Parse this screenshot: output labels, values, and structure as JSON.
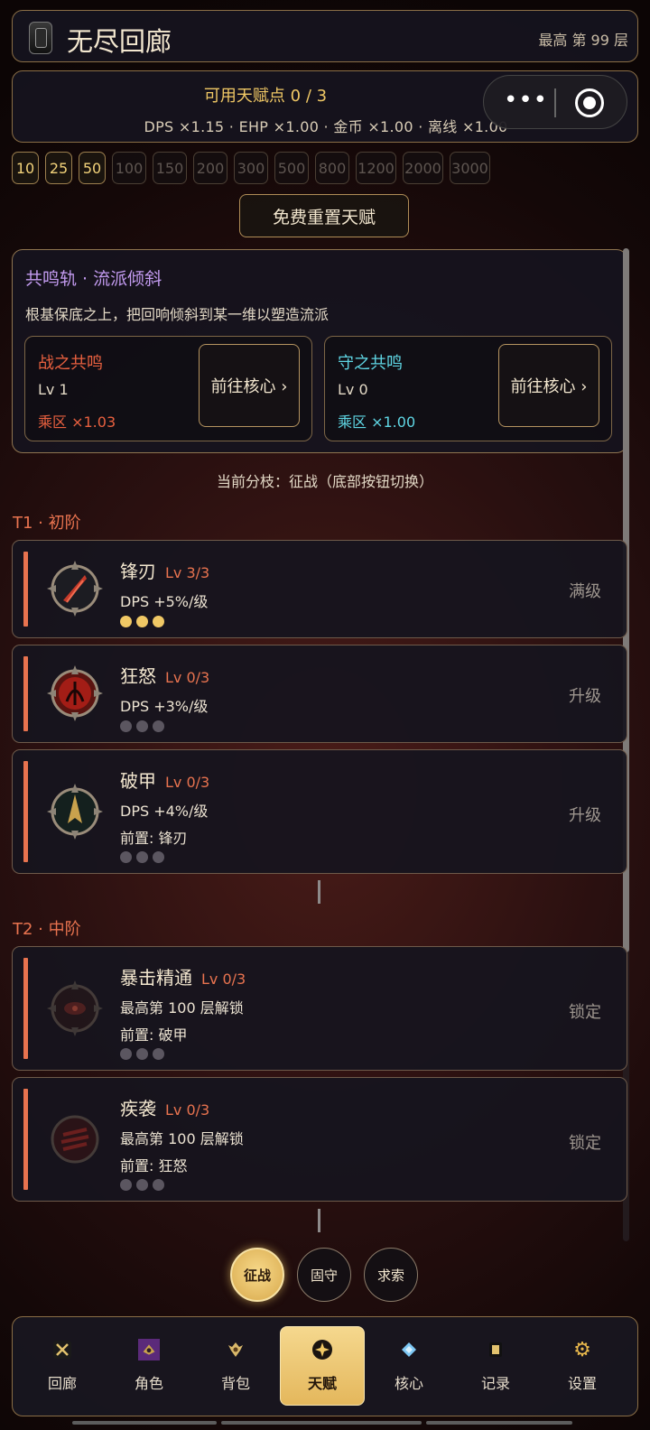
{
  "header": {
    "title": "无尽回廊",
    "best_floor": "最高 第 99 层"
  },
  "talents": {
    "points": "可用天赋点 0 / 3",
    "multipliers": "DPS ×1.15  ·  EHP ×1.00  ·  金币 ×1.00  ·  离线 ×1.00"
  },
  "floors": [
    {
      "label": "10",
      "active": true
    },
    {
      "label": "25",
      "active": true
    },
    {
      "label": "50",
      "active": true
    },
    {
      "label": "100",
      "active": false
    },
    {
      "label": "150",
      "active": false
    },
    {
      "label": "200",
      "active": false
    },
    {
      "label": "300",
      "active": false
    },
    {
      "label": "500",
      "active": false
    },
    {
      "label": "800",
      "active": false
    },
    {
      "label": "1200",
      "active": false
    },
    {
      "label": "2000",
      "active": false
    },
    {
      "label": "3000",
      "active": false
    }
  ],
  "reset_button": "免费重置天赋",
  "resonance": {
    "title": "共鸣轨 · 流派倾斜",
    "desc": "根基保底之上，把回响倾斜到某一维以塑造流派",
    "cards": [
      {
        "name": "战之共鸣",
        "lv": "Lv 1",
        "mult": "乘区 ×1.03",
        "go": "前往核心 ›"
      },
      {
        "name": "守之共鸣",
        "lv": "Lv 0",
        "mult": "乘区 ×1.00",
        "go": "前往核心 ›"
      }
    ]
  },
  "branch_note": "当前分枝：征战（底部按钮切换）",
  "tiers": [
    {
      "label": "T1 · 初阶"
    },
    {
      "label": "T2 · 中阶"
    }
  ],
  "talent_cards": [
    {
      "name": "锋刃",
      "lv": "Lv 3/3",
      "line1": "DPS +5%/级",
      "line2": "",
      "level": 3,
      "max": 3,
      "state": "满级"
    },
    {
      "name": "狂怒",
      "lv": "Lv 0/3",
      "line1": "DPS +3%/级",
      "line2": "",
      "level": 0,
      "max": 3,
      "state": "升级"
    },
    {
      "name": "破甲",
      "lv": "Lv 0/3",
      "line1": "DPS +4%/级",
      "line2": "前置: 锋刃",
      "level": 0,
      "max": 3,
      "state": "升级"
    },
    {
      "name": "暴击精通",
      "lv": "Lv 0/3",
      "line1": "最高第 100 层解锁",
      "line2": "前置: 破甲",
      "level": 0,
      "max": 3,
      "state": "锁定"
    },
    {
      "name": "疾袭",
      "lv": "Lv 0/3",
      "line1": "最高第 100 层解锁",
      "line2": "前置: 狂怒",
      "level": 0,
      "max": 3,
      "state": "锁定"
    }
  ],
  "branches": [
    {
      "label": "征战",
      "active": true
    },
    {
      "label": "固守",
      "active": false
    },
    {
      "label": "求索",
      "active": false
    }
  ],
  "nav": [
    {
      "label": "回廊",
      "icon": "crossed-swords-icon",
      "active": false
    },
    {
      "label": "角色",
      "icon": "character-icon",
      "active": false
    },
    {
      "label": "背包",
      "icon": "backpack-icon",
      "active": false
    },
    {
      "label": "天赋",
      "icon": "talent-star-icon",
      "active": true
    },
    {
      "label": "核心",
      "icon": "diamond-core-icon",
      "active": false
    },
    {
      "label": "记录",
      "icon": "scroll-icon",
      "active": false
    },
    {
      "label": "设置",
      "icon": "gear-icon",
      "active": false
    }
  ],
  "colors": {
    "accent": "#f0c865",
    "stripe": "#e8734f",
    "war": "#e8603f",
    "guard": "#5fd6e4",
    "resonance_title": "#c39bf0"
  }
}
